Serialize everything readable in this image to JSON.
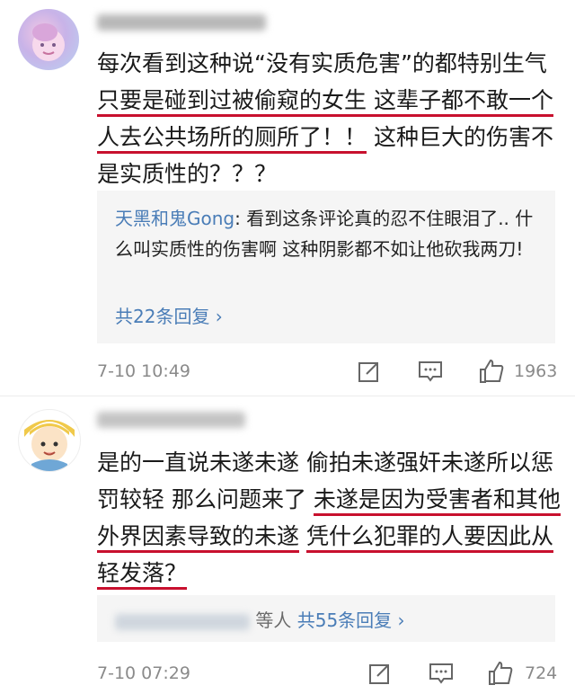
{
  "comments": [
    {
      "body_segments": [
        {
          "text": "每次看到这种说“没有实质危害”的都特别生气 ",
          "underline": false
        },
        {
          "text": "只要是碰到过被偷窥的女生 这辈子都不敢一个人去公共场所的厕所了！！",
          "underline": true
        },
        {
          "text": " 这种巨大的伤害不是实质性的？？？",
          "underline": false
        }
      ],
      "reply": {
        "user": "天黑和鬼Gong",
        "text": ": 看到这条评论真的忍不住眼泪了.. 什么叫实质性的伤害啊 这种阴影都不如让他砍我两刀!",
        "more": "共22条回复 ›"
      },
      "time": "7-10 10:49",
      "likes": "1963"
    },
    {
      "body_segments": [
        {
          "text": "是的一直说未遂未遂 偷拍未遂强奸未遂所以惩罚较轻 那么问题来了 ",
          "underline": false
        },
        {
          "text": "未遂是因为受害者和其他外界因素导致的未遂",
          "underline": true
        },
        {
          "text": " ",
          "underline": false
        },
        {
          "text": "凭什么犯罪的人要因此从轻发落？",
          "underline": true
        }
      ],
      "reply": {
        "suffix": "等人",
        "more": "共55条回复 ›"
      },
      "time": "7-10 07:29",
      "likes": "724"
    }
  ],
  "icons": {
    "edit": "edit-icon",
    "comment": "comment-icon",
    "like": "thumbs-up-icon",
    "accent_color": "#c8102e",
    "link_color": "#4a7db7"
  }
}
